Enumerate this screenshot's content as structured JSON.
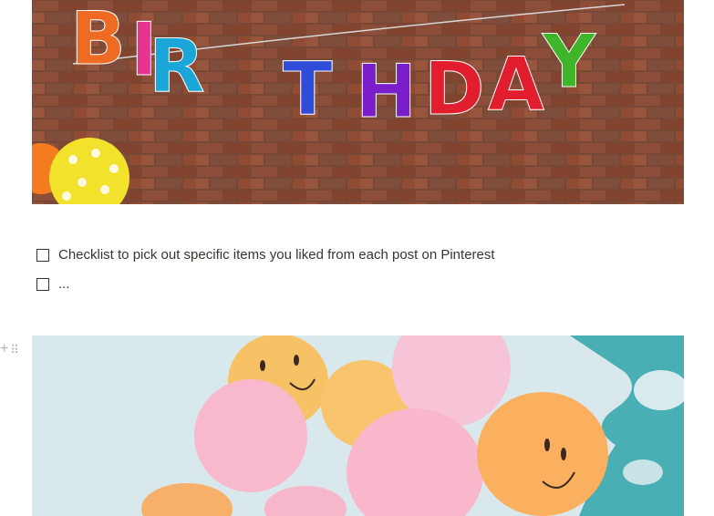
{
  "images": {
    "top": {
      "banner_text": "BIRTHDAY"
    },
    "bottom": {}
  },
  "checklist": {
    "items": [
      {
        "text": "Checklist to pick out specific items you liked from each post on Pinterest",
        "checked": false
      },
      {
        "text": "...",
        "checked": false
      }
    ]
  },
  "block_handle": {
    "add_icon": "plus-icon",
    "drag_icon": "drag-handle-icon"
  },
  "colors": {
    "text": "#37352f",
    "handle": "#b4b4b0",
    "brick": "#8a4a36",
    "sky": "#d4e6ec",
    "cloud_teal": "#4ab2b8"
  }
}
